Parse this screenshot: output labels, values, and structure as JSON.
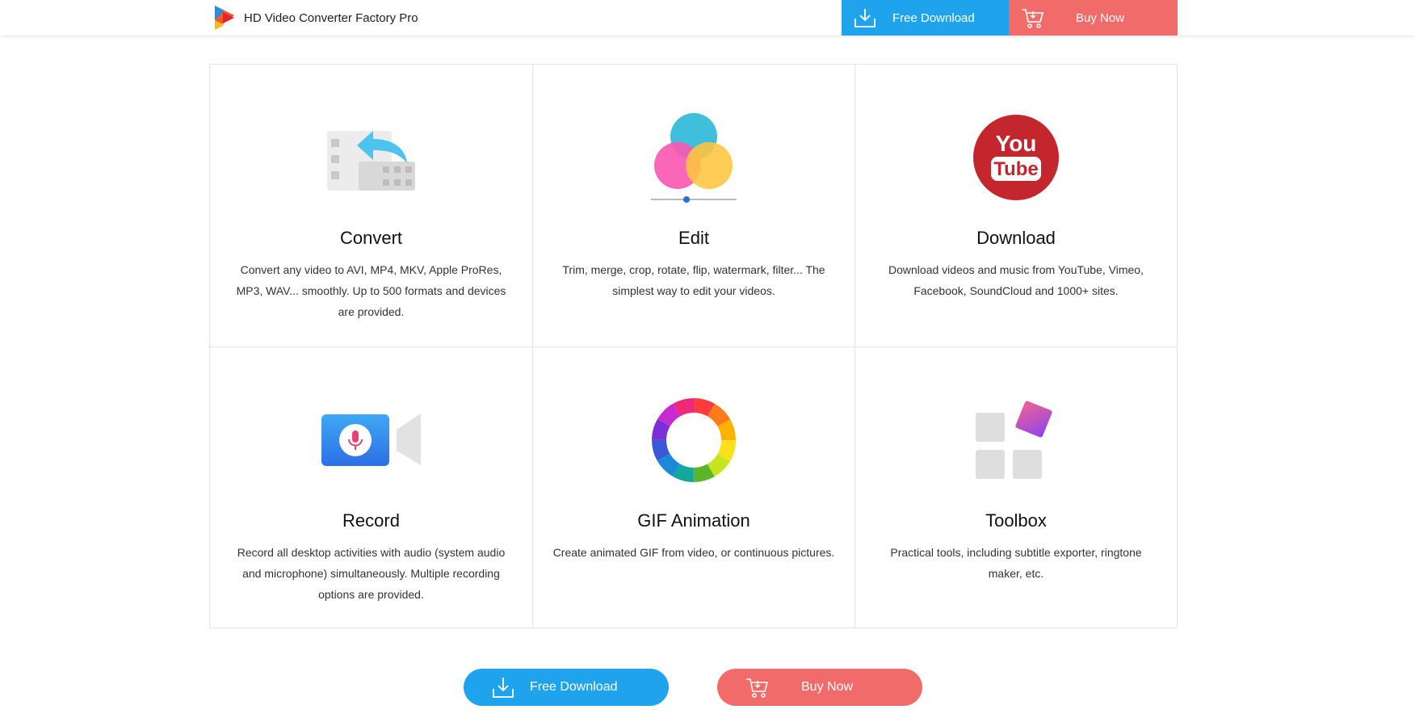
{
  "header": {
    "brand_title": "HD Video Converter Factory Pro",
    "free_download_label": "Free Download",
    "buy_now_label": "Buy Now"
  },
  "features": [
    {
      "title": "Convert",
      "description": "Convert any video to AVI, MP4, MKV, Apple ProRes, MP3, WAV... smoothly. Up to 500 formats and devices are provided.",
      "icon": "convert-icon"
    },
    {
      "title": "Edit",
      "description": "Trim, merge, crop, rotate, flip, watermark, filter... The simplest way to edit your videos.",
      "icon": "edit-icon"
    },
    {
      "title": "Download",
      "description": "Download videos and music from YouTube, Vimeo, Facebook, SoundCloud and 1000+ sites.",
      "icon": "youtube-icon",
      "icon_text": [
        "You",
        "Tube"
      ]
    },
    {
      "title": "Record",
      "description": "Record all desktop activities with audio (system audio and microphone) simultaneously. Multiple recording options are provided.",
      "icon": "record-icon"
    },
    {
      "title": "GIF Animation",
      "description": "Create animated GIF from video, or continuous pictures.",
      "icon": "gif-animation-icon"
    },
    {
      "title": "Toolbox",
      "description": "Practical tools, including subtitle exporter, ringtone maker, etc.",
      "icon": "toolbox-icon"
    }
  ],
  "cta": {
    "free_download_label": "Free Download",
    "buy_now_label": "Buy Now"
  },
  "colors": {
    "free_download": "#1fa3ec",
    "buy_now": "#f26b6b",
    "youtube_red": "#c4262e"
  }
}
